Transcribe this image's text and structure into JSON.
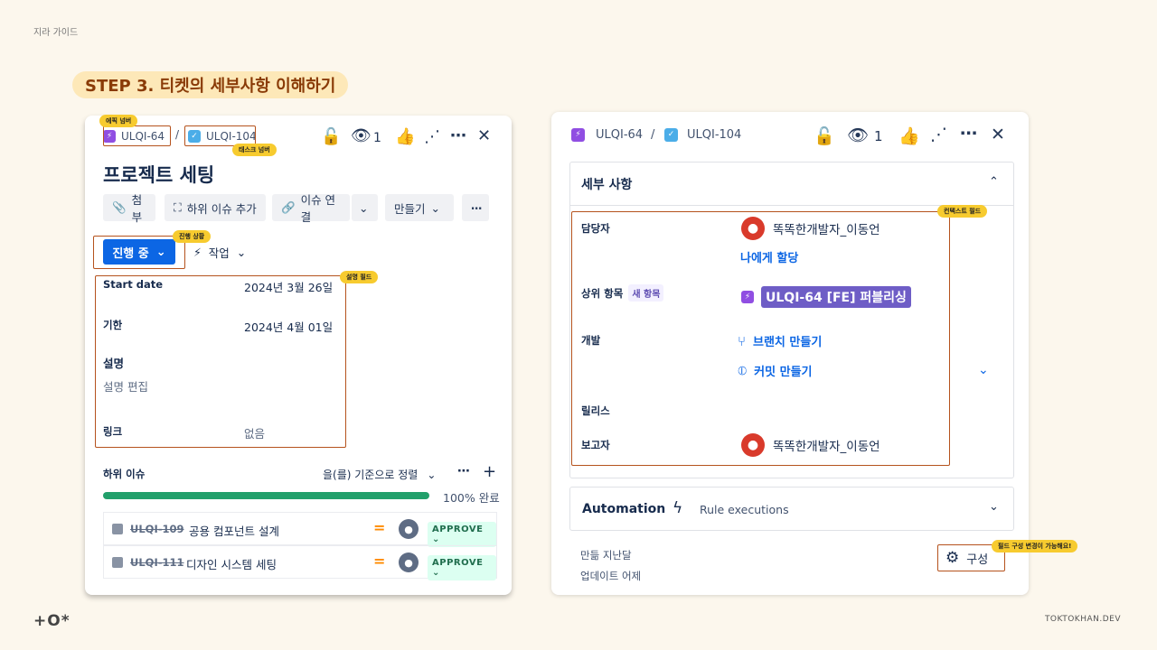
{
  "guide": {
    "title": "지라 가이드",
    "step": "STEP 3. 티켓의 세부사항 이해하기",
    "logo": "+O*",
    "site": "TOKTOKHAN.DEV"
  },
  "left": {
    "epic_key": "ULQI-64",
    "task_key": "ULQI-104",
    "breadcrumb_sep": "/",
    "watch_count": "1",
    "title": "프로젝트 세팅",
    "actions": {
      "attach": "첨부",
      "add_child": "하위 이슈 추가",
      "link_issue": "이슈 연결",
      "create": "만들기"
    },
    "status": "진행 중",
    "action_label": "작업",
    "fields": {
      "start_date_label": "Start date",
      "start_date_value": "2024년 3월 26일",
      "due_label": "기한",
      "due_value": "2024년 4월 01일",
      "desc_label": "설명",
      "desc_placeholder": "설명 편집",
      "link_label": "링크",
      "link_value": "없음"
    },
    "subtasks": {
      "header": "하위 이슈",
      "sort": "을(를) 기준으로 정렬",
      "progress_pct": 100,
      "progress_text": "100% 완료",
      "items": [
        {
          "key": "ULQI-109",
          "summary": "공용 컴포넌트 설계",
          "status": "APPROVE"
        },
        {
          "key": "ULQI-111",
          "summary": "디자인 시스템 세팅",
          "status": "APPROVE"
        }
      ]
    },
    "tags": {
      "epic_num": "에픽 넘버",
      "task_num": "태스크 넘버",
      "progress_status": "진행 상황",
      "desc_field": "설명 필드"
    }
  },
  "right": {
    "epic_key": "ULQI-64",
    "task_key": "ULQI-104",
    "breadcrumb_sep": "/",
    "watch_count": "1",
    "details_header": "세부 사항",
    "assignee_label": "담당자",
    "assignee_name": "똑똑한개발자_이동언",
    "assign_me": "나에게 할당",
    "parent_label": "상위 항목",
    "parent_badge": "새 항목",
    "parent_value": "ULQI-64 [FE] 퍼블리싱",
    "dev_label": "개발",
    "branch": "브랜치 만들기",
    "commit": "커밋 만들기",
    "release_label": "릴리스",
    "reporter_label": "보고자",
    "reporter_name": "똑똑한개발자_이동언",
    "automation": "Automation",
    "rule_exec": "Rule executions",
    "created": "만듦 지난달",
    "updated": "업데이트 어제",
    "configure": "구성",
    "tags": {
      "context_field": "컨텍스트 필드",
      "field_config": "필드 구성 변경이 가능해요!"
    }
  }
}
